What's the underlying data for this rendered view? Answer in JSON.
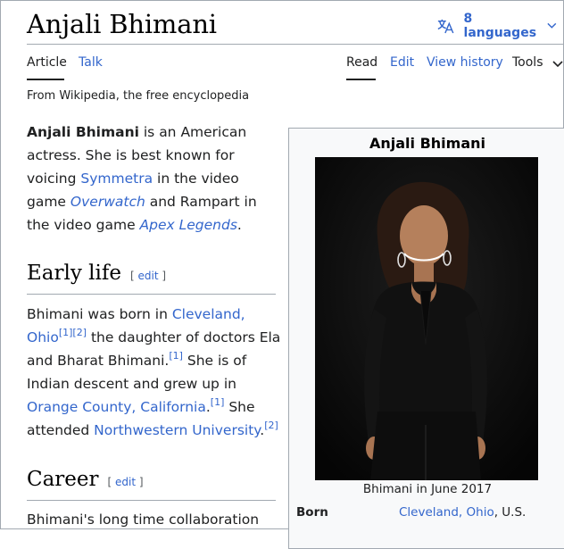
{
  "article": {
    "title": "Anjali Bhimani",
    "languages_label": "8 languages",
    "tagline": "From Wikipedia, the free encyclopedia"
  },
  "tabs": {
    "article": "Article",
    "talk": "Talk",
    "read": "Read",
    "edit": "Edit",
    "history": "View history",
    "tools": "Tools"
  },
  "intro": {
    "name": "Anjali Bhimani",
    "t1": " is an American actress. She is best known for voicing ",
    "symmetra": "Symmetra",
    "t2": " in the video game ",
    "overwatch": "Overwatch",
    "t3": " and Rampart in the video game ",
    "apex": "Apex Legends",
    "t4": "."
  },
  "early_life": {
    "heading": "Early life",
    "edit_open": "[ ",
    "edit": "edit",
    "edit_close": " ]",
    "t1": "Bhimani was born in ",
    "cleveland": "Cleveland, Ohio",
    "ref1": "[1]",
    "ref2": "[2]",
    "t2": " the daughter of doctors Ela and Bharat Bhimani.",
    "ref3": "[1]",
    "t3": " She is of Indian descent and grew up in ",
    "orange": "Orange County, California",
    "ref4": "[1]",
    "t4": " She attended ",
    "nwu": "Northwestern University",
    "t5": ".",
    "ref5": "[2]"
  },
  "career": {
    "heading": "Career",
    "edit_open": "[ ",
    "edit": "edit",
    "edit_close": " ]",
    "text": "Bhimani's long time collaboration"
  },
  "infobox": {
    "title": "Anjali Bhimani",
    "caption": "Bhimani in June 2017",
    "born_label": "Born",
    "born_city": "Cleveland, Ohio",
    "born_rest": ", U.S."
  },
  "icons": {
    "language": "translate-icon",
    "chevron": "chevron-down-icon"
  },
  "colors": {
    "link": "#3366cc",
    "text": "#202122",
    "rule": "#a2a9b1",
    "infobox_bg": "#f8f9fa"
  }
}
